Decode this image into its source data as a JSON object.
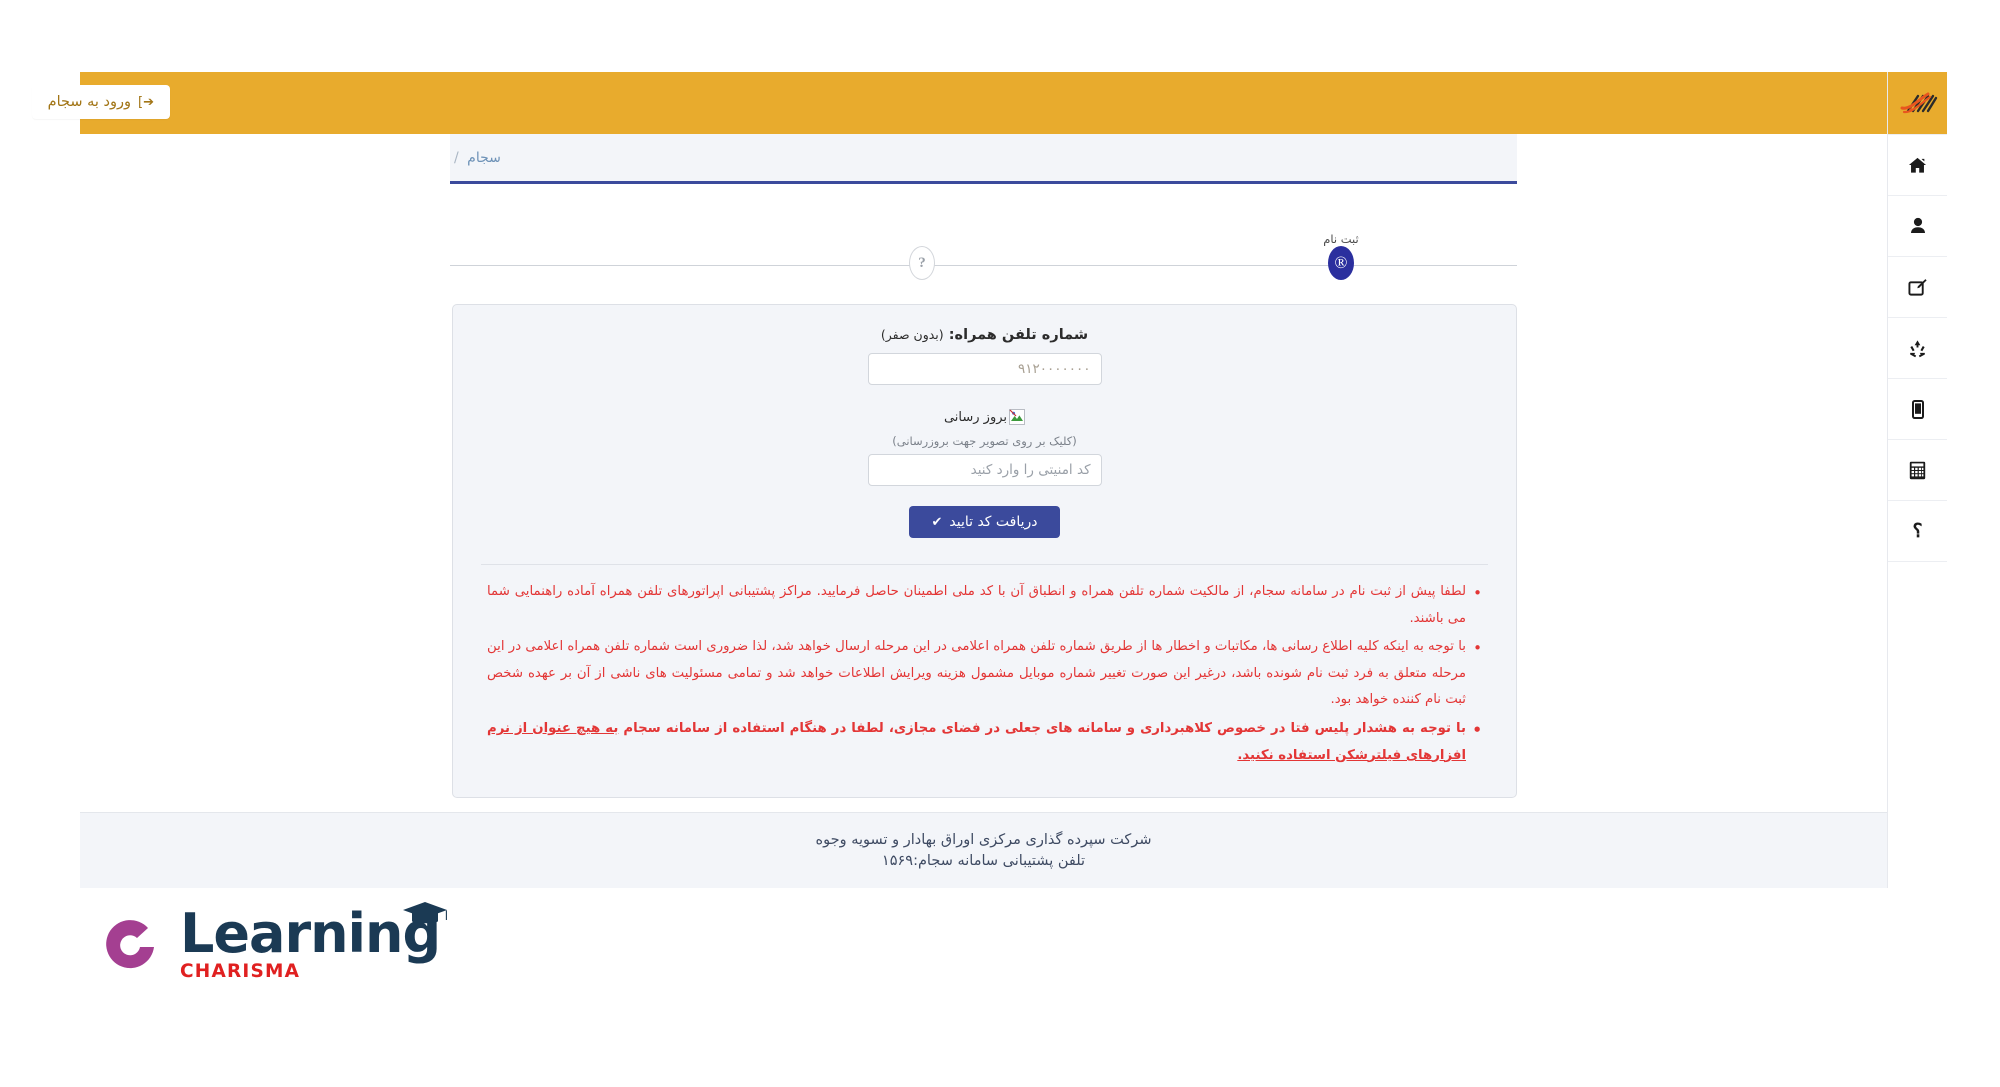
{
  "window": {
    "direction": "rtl",
    "language": "fa"
  },
  "colors": {
    "topbar_orange": "#e8ab2d",
    "primary_blue": "#3b4a9c",
    "step_active_blue": "#2b2f9e",
    "warning_red": "#e33636",
    "panel_bg": "#f3f5f9",
    "brand_purple": "#a43f91",
    "brand_navy": "#1b3a54",
    "brand_red": "#e02020"
  },
  "topbar": {
    "login_button_label": "ورود به سجام",
    "login_button_icon": "sign-in-icon"
  },
  "sidebar": {
    "logo_alt": "csdi-logo",
    "items": [
      {
        "icon": "home-icon",
        "name": "sidebar-item-home"
      },
      {
        "icon": "user-icon",
        "name": "sidebar-item-profile"
      },
      {
        "icon": "edit-square-icon",
        "name": "sidebar-item-edit"
      },
      {
        "icon": "recycle-icon",
        "name": "sidebar-item-recycle"
      },
      {
        "icon": "mobile-icon",
        "name": "sidebar-item-mobile"
      },
      {
        "icon": "calculator-icon",
        "name": "sidebar-item-calculator"
      },
      {
        "icon": "question-mark-icon",
        "name": "sidebar-item-help",
        "glyph": "؟"
      }
    ]
  },
  "breadcrumb": {
    "separator": "/",
    "current": "سجام"
  },
  "stepper": {
    "steps": [
      {
        "label": "",
        "glyph": "?",
        "state": "inactive",
        "name": "step-unknown"
      },
      {
        "label": "ثبت نام",
        "glyph": "®",
        "state": "active",
        "name": "step-register"
      }
    ]
  },
  "form": {
    "phone": {
      "label_bold": "شماره تلفن همراه:",
      "label_hint": "(بدون صفر)",
      "placeholder": "۹۱۲۰۰۰۰۰۰۰",
      "value": ""
    },
    "captcha": {
      "broken_image_alt": "بروز رسانی",
      "hint": "(کلیک بر روی تصویر جهت بروزرسانی)",
      "input_placeholder": "کد امنیتی را وارد کنید",
      "input_value": ""
    },
    "submit": {
      "label": "دریافت کد تایید",
      "icon": "check-icon"
    }
  },
  "notes": [
    {
      "text": "لطفا پیش از ثبت نام در سامانه سجام، از مالکیت شماره تلفن همراه و انطباق آن با کد ملی اطمینان حاصل فرمایید. مراکز پشتیبانی اپراتورهای تلفن همراه آماده راهنمایی شما می باشند.",
      "bold": false
    },
    {
      "text": "با توجه به اینکه کلیه اطلاع رسانی ها، مکاتبات و اخطار ها از طریق شماره تلفن همراه اعلامی در این مرحله ارسال خواهد شد، لذا ضروری است شماره تلفن همراه اعلامی در این مرحله متعلق به فرد ثبت نام شونده باشد، درغیر این صورت تغییر شماره موبایل مشمول هزینه ویرایش اطلاعات خواهد شد و تمامی مسئولیت های ناشی از آن بر عهده شخص ثبت نام کننده خواهد بود.",
      "bold": false
    },
    {
      "text_prefix": "با توجه به هشدار پلیس فتا در خصوص کلاهبرداری و سامانه های جعلی در فضای مجازی، لطفا در هنگام استفاده از سامانه سجام ",
      "text_strong": "به هیچ عنوان از نرم افزارهای فیلترشکن استفاده نکنید.",
      "bold": true
    }
  ],
  "footer": {
    "line1": "شرکت سپرده گذاری مرکزی اوراق بهادار و تسویه وجوه",
    "line2": "تلفن پشتیبانی سامانه سجام:۱۵۶۹"
  },
  "brand": {
    "word": "Learning",
    "sub": "CHARISMA",
    "mark": "c-arc-icon",
    "cap": "graduation-cap-icon"
  }
}
